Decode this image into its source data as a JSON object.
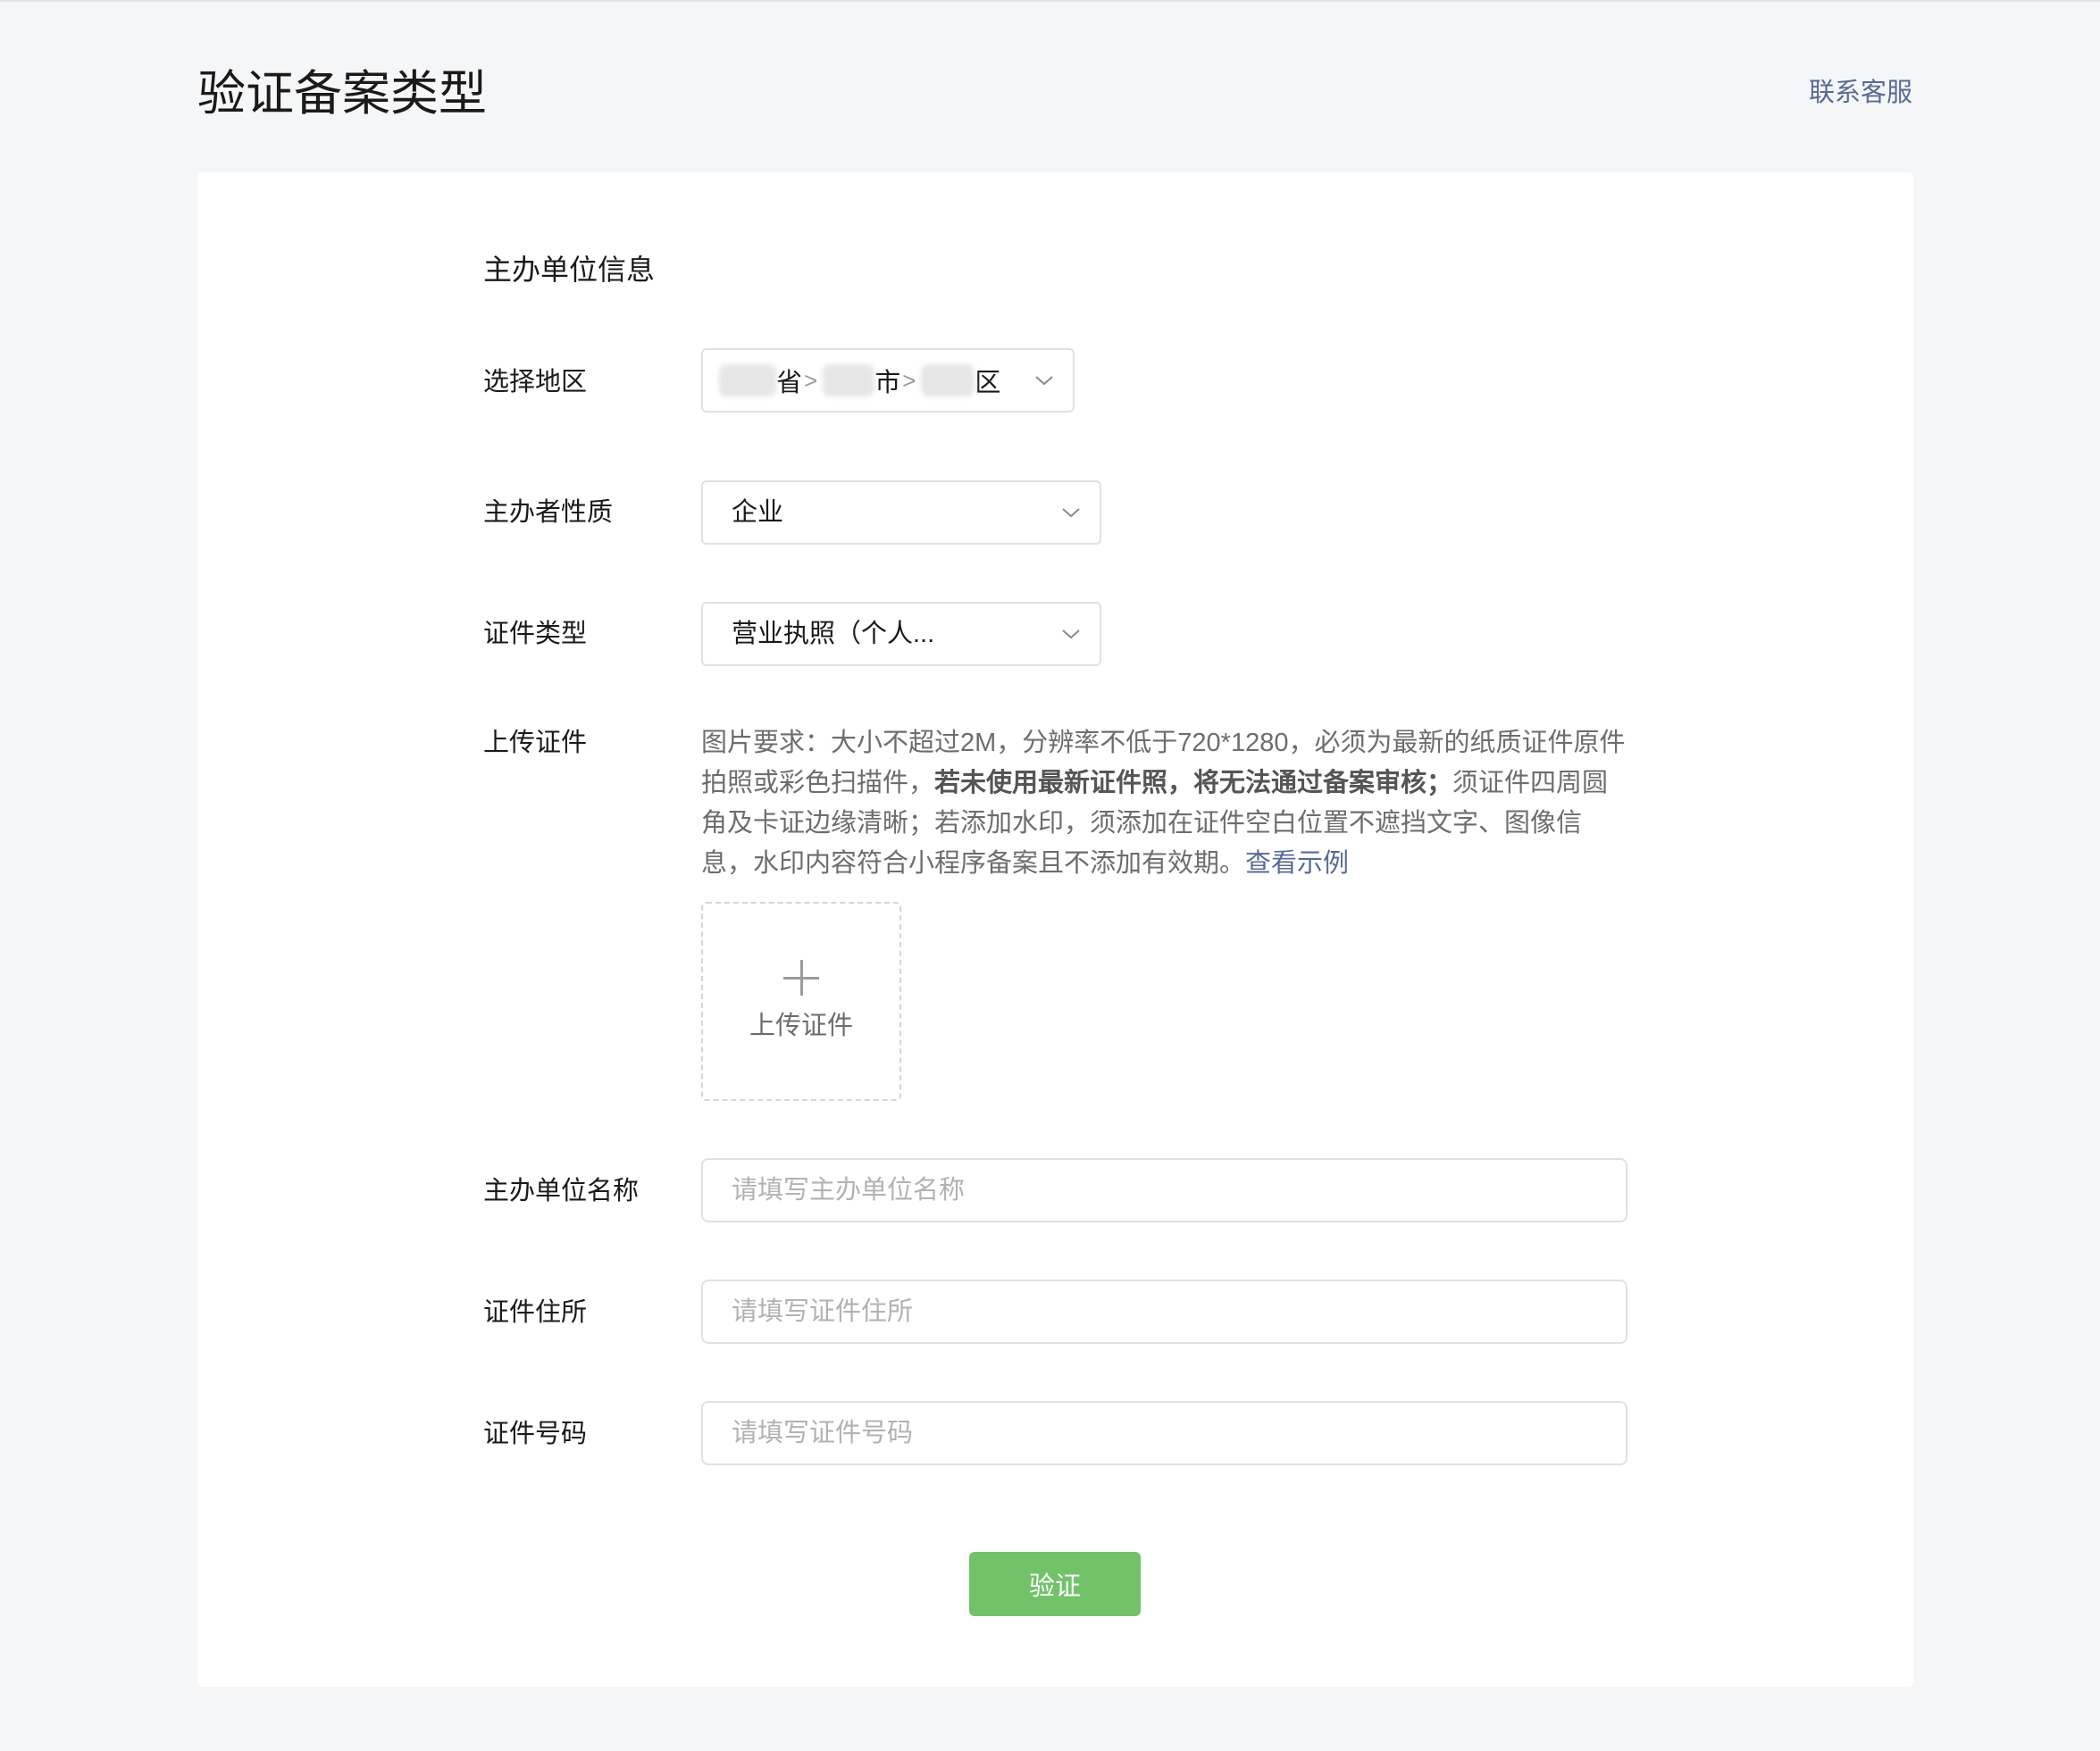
{
  "header": {
    "title": "验证备案类型",
    "contact_label": "联系客服"
  },
  "form": {
    "section_title": "主办单位信息",
    "region": {
      "label": "选择地区",
      "province_suffix": "省",
      "city_suffix": "市",
      "district_suffix": "区",
      "separator": ">",
      "icon": "chevron-down-icon"
    },
    "organizer_type": {
      "label": "主办者性质",
      "value": "企业",
      "icon": "chevron-down-icon"
    },
    "cert_type": {
      "label": "证件类型",
      "value": "营业执照（个人...",
      "icon": "chevron-down-icon"
    },
    "upload": {
      "label": "上传证件",
      "hint_part1": "图片要求：大小不超过2M，分辨率不低于720*1280，必须为最新的纸质证件原件拍照或彩色扫描件，",
      "hint_bold": "若未使用最新证件照，将无法通过备案审核；",
      "hint_part2": "须证件四周圆角及卡证边缘清晰；若添加水印，须添加在证件空白位置不遮挡文字、图像信息，水印内容符合小程序备案且不添加有效期。",
      "example_link": "查看示例",
      "button_label": "上传证件",
      "icon": "plus-icon"
    },
    "org_name": {
      "label": "主办单位名称",
      "placeholder": "请填写主办单位名称"
    },
    "cert_address": {
      "label": "证件住所",
      "placeholder": "请填写证件住所"
    },
    "cert_number": {
      "label": "证件号码",
      "placeholder": "请填写证件号码"
    },
    "submit_label": "验证"
  },
  "colors": {
    "background": "#f5f6f8",
    "card": "#ffffff",
    "link": "#576b95",
    "primary_button": "#72c26a",
    "border": "#e1e1e1"
  }
}
